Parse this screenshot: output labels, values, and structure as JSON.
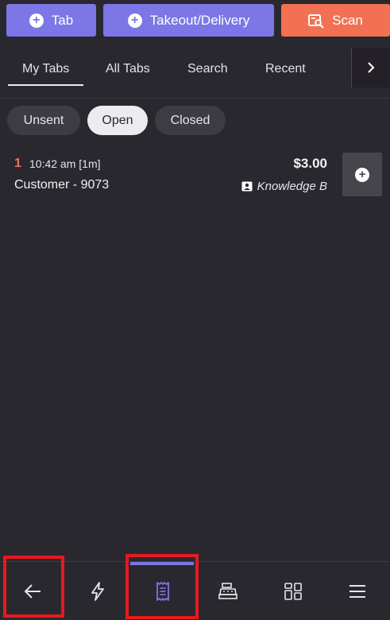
{
  "top_actions": {
    "tab_label": "Tab",
    "takeout_label": "Takeout/Delivery",
    "scan_label": "Scan"
  },
  "tabs": {
    "items": [
      "My Tabs",
      "All Tabs",
      "Search",
      "Recent"
    ],
    "active": "My Tabs"
  },
  "filters": {
    "unsent": "Unsent",
    "open": "Open",
    "closed": "Closed",
    "selected": "Open"
  },
  "entries": [
    {
      "number": "1",
      "time": "10:42 am [1m]",
      "customer": "Customer - 9073",
      "amount": "$3.00",
      "staff": "Knowledge B"
    }
  ],
  "bottom_nav": {
    "items": [
      "back",
      "quick-actions",
      "tabs",
      "register",
      "apps",
      "menu"
    ],
    "active": "tabs"
  },
  "colors": {
    "background": "#2a282f",
    "accent": "#7c76e6",
    "scan": "#f27152",
    "highlight": "#e8191c"
  }
}
